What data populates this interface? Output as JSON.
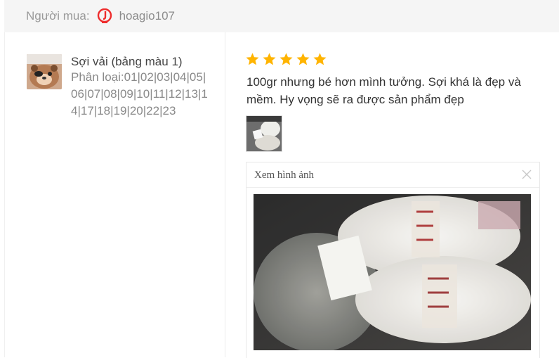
{
  "header": {
    "buyer_label": "Người mua:",
    "buyer_icon": "brand-logo-icon",
    "buyer_name": "hoagio107"
  },
  "product": {
    "name": "Sợi vải (bảng màu 1)",
    "variant": "Phân loại:01|02|03|04|05|06|07|08|09|10|11|12|13|14|17|18|19|20|22|23"
  },
  "review": {
    "rating": 5,
    "rating_max": 5,
    "text": "100gr nhưng bé hơn mình tưởng. Sợi khá là đẹp và mềm. Hy vọng sẽ ra được sản phẩm đẹp"
  },
  "viewer": {
    "title": "Xem hình ảnh",
    "close_icon": "close-icon"
  },
  "colors": {
    "star": "#ffb400",
    "brand": "#ee2c2c"
  }
}
